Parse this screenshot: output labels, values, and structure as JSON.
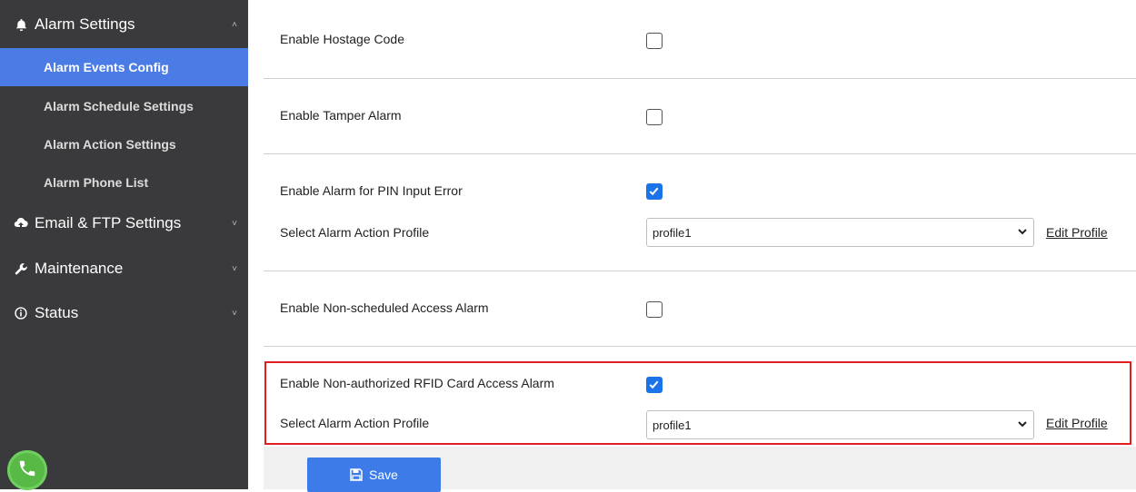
{
  "sidebar": {
    "groups": [
      {
        "label": "Alarm Settings",
        "icon": "bell-icon"
      },
      {
        "label": "Email & FTP Settings",
        "icon": "cloud-icon"
      },
      {
        "label": "Maintenance",
        "icon": "wrench-icon"
      },
      {
        "label": "Status",
        "icon": "info-icon"
      }
    ],
    "items": [
      {
        "label": "Alarm Events Config",
        "active": true
      },
      {
        "label": "Alarm Schedule Settings"
      },
      {
        "label": "Alarm Action Settings"
      },
      {
        "label": "Alarm Phone List"
      }
    ],
    "phone_icon": "phone-icon"
  },
  "settings": {
    "hostage": {
      "label": "Enable Hostage Code",
      "checked": false
    },
    "tamper": {
      "label": "Enable Tamper Alarm",
      "checked": false
    },
    "pin": {
      "label": "Enable Alarm for PIN Input Error",
      "checked": true,
      "profile_label": "Select Alarm Action Profile",
      "profile_value": "profile1",
      "edit_label": "Edit Profile"
    },
    "nonscheduled": {
      "label": "Enable Non-scheduled Access Alarm",
      "checked": false
    },
    "rfid": {
      "label": "Enable Non-authorized RFID Card Access Alarm",
      "checked": true,
      "profile_label": "Select Alarm Action Profile",
      "profile_value": "profile1",
      "edit_label": "Edit Profile"
    }
  },
  "footer": {
    "save_label": "Save",
    "save_icon": "floppy-disk-icon"
  },
  "colors": {
    "sidebar_bg": "#3a3a3c",
    "active_item": "#4b7be5",
    "checkbox_checked": "#1a73e8",
    "save_button": "#3d7be8",
    "highlight_border": "#e02020"
  }
}
